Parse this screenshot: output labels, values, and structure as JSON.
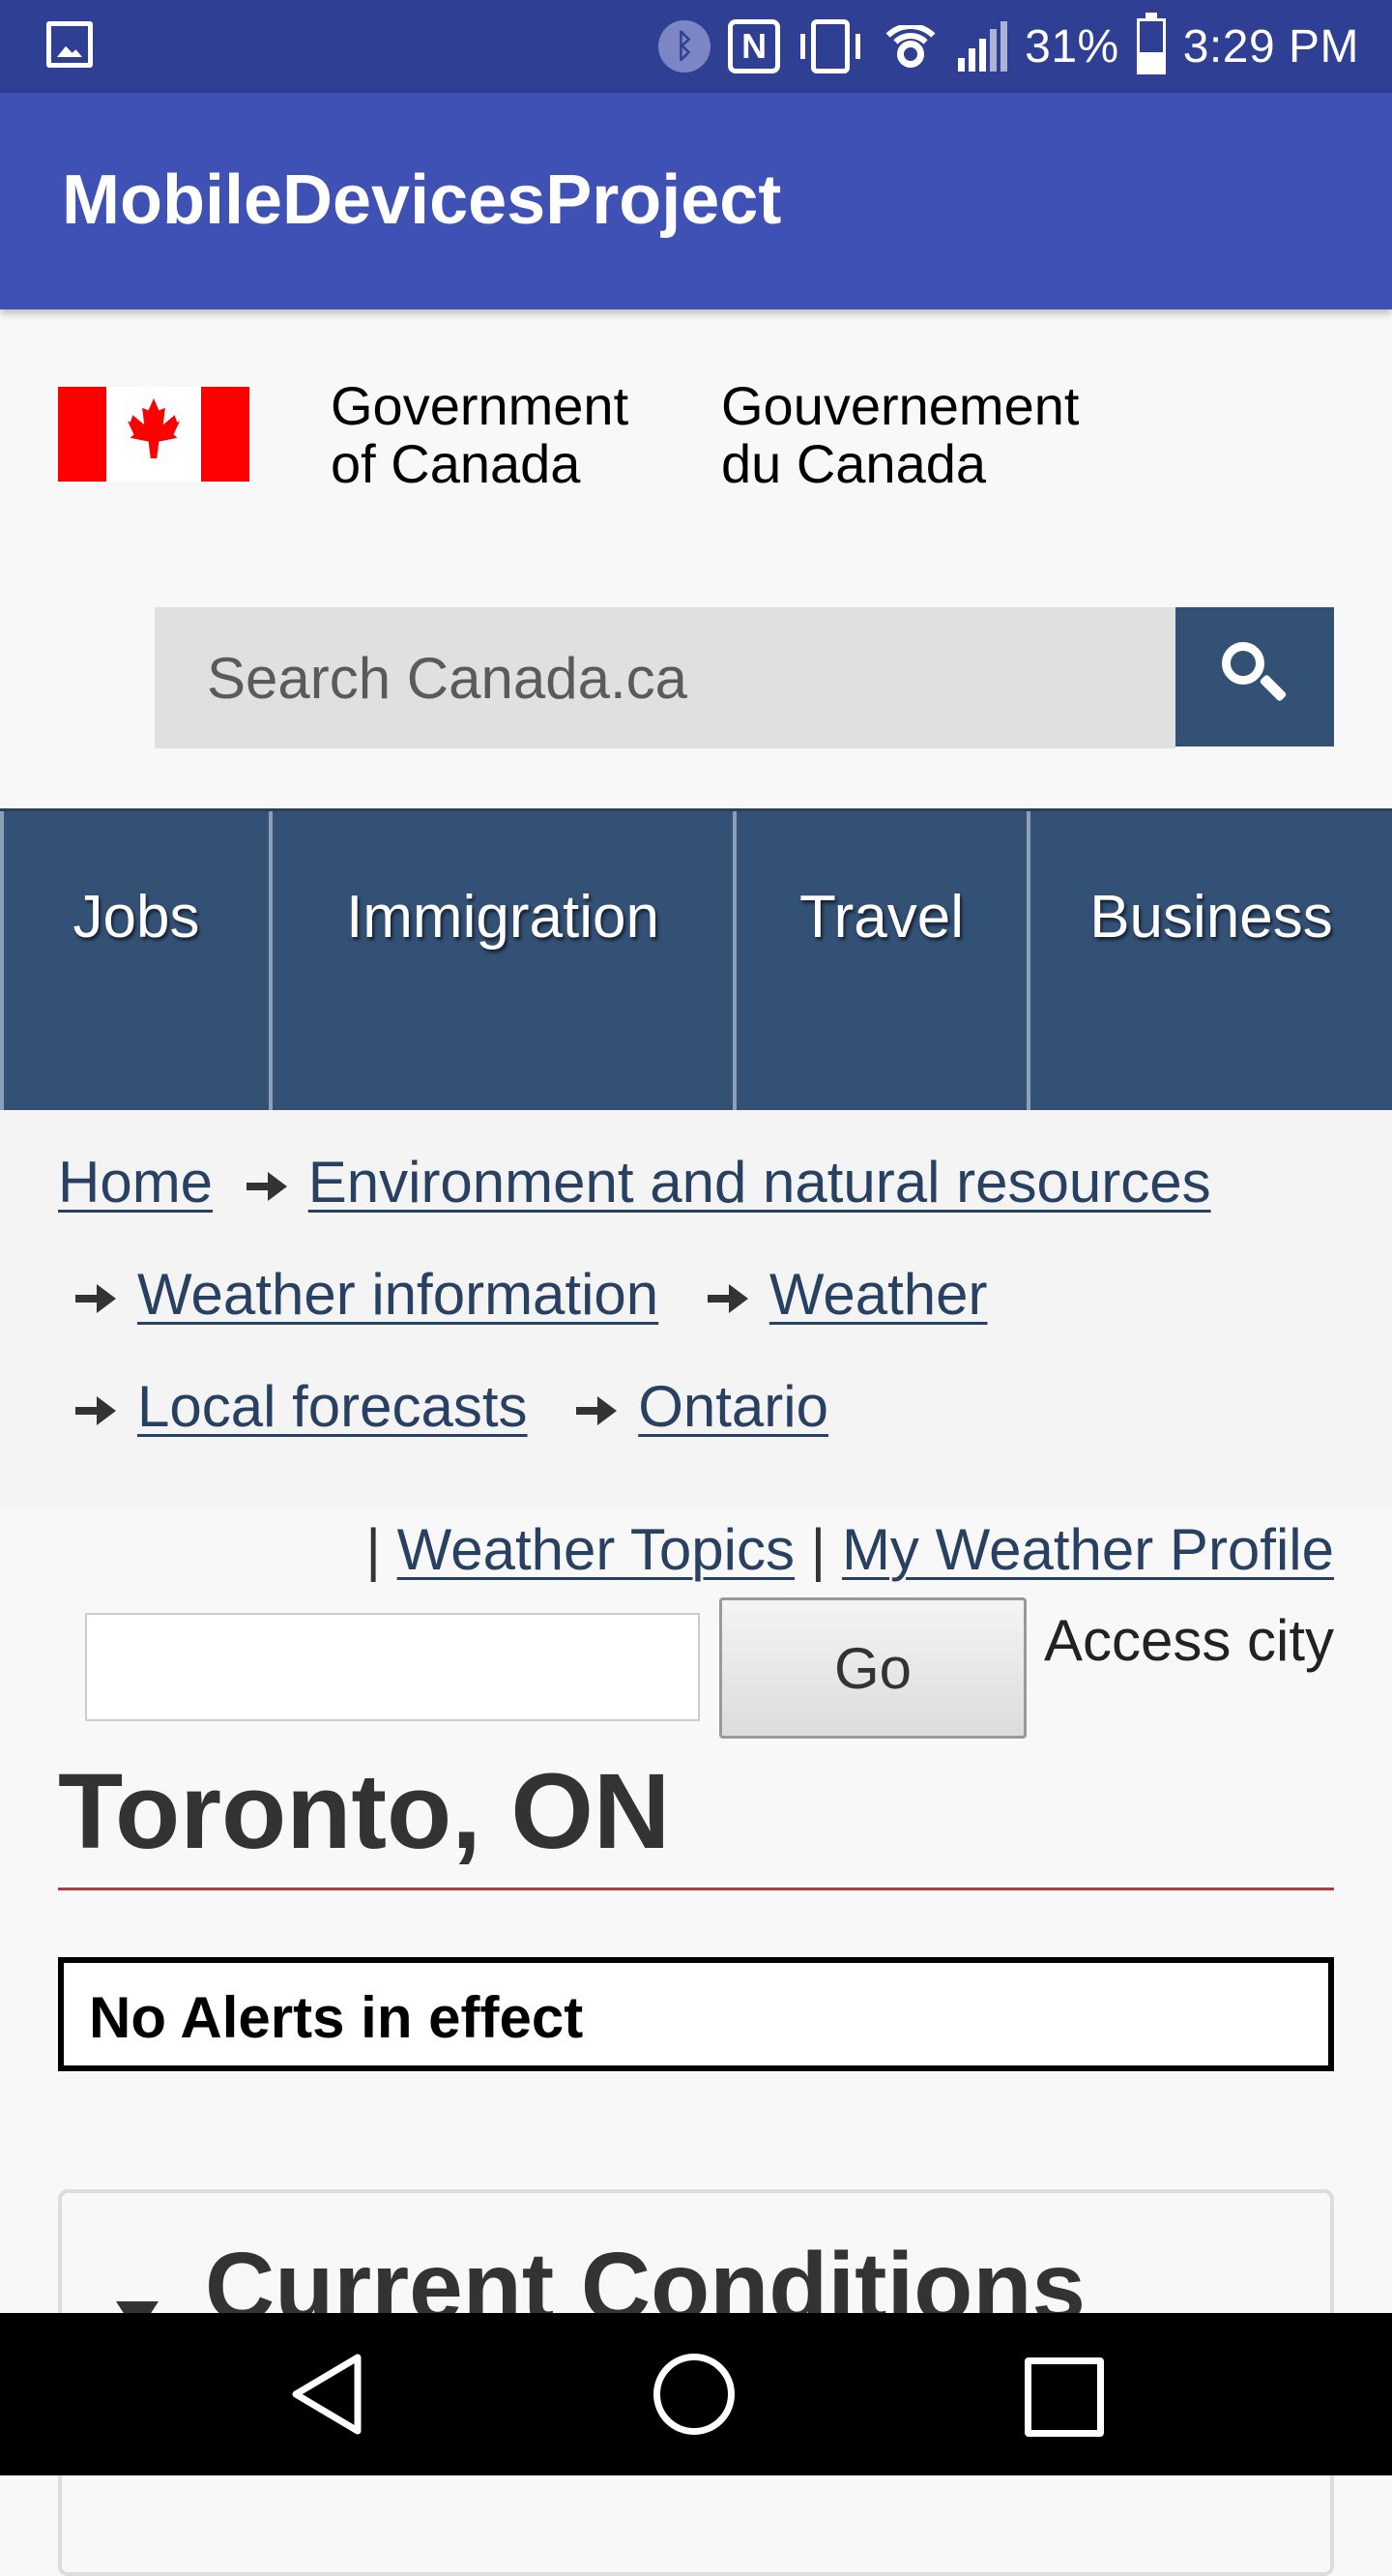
{
  "status_bar": {
    "battery": "31%",
    "time": "3:29 PM",
    "icons": [
      "gallery-icon",
      "bluetooth-icon",
      "nfc-icon",
      "vibrate-icon",
      "wifi-icon",
      "signal-icon",
      "battery-icon"
    ]
  },
  "app_bar": {
    "title": "MobileDevicesProject"
  },
  "gov_header": {
    "en_line1": "Government",
    "en_line2": "of Canada",
    "fr_line1": "Gouvernement",
    "fr_line2": "du Canada"
  },
  "search": {
    "placeholder": "Search Canada.ca"
  },
  "menu": {
    "items": [
      "Jobs",
      "Immigration",
      "Travel",
      "Business"
    ]
  },
  "breadcrumb": {
    "home": "Home",
    "environment": "Environment and natural resources",
    "weather_information": "Weather information",
    "weather": "Weather",
    "local_forecasts": "Local forecasts",
    "ontario": "Ontario"
  },
  "weather_links": {
    "separator": "|",
    "topics": "Weather Topics",
    "profile": "My Weather Profile"
  },
  "city_form": {
    "input_value": "",
    "go_label": "Go",
    "access_city_label": "Access city"
  },
  "city": {
    "title": "Toronto, ON"
  },
  "alerts": {
    "text": "No Alerts in effect"
  },
  "conditions": {
    "heading": "Current Conditions"
  },
  "colors": {
    "status_bar": "#2f3f94",
    "app_bar": "#3f51b5",
    "nav_menu": "#335075",
    "link": "#284162",
    "rule": "#af3c43",
    "flag_red": "#ff0000"
  }
}
